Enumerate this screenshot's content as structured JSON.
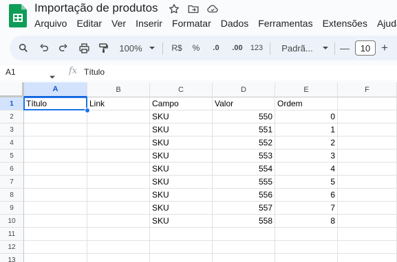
{
  "document": {
    "title": "Importação de produtos"
  },
  "menu": [
    "Arquivo",
    "Editar",
    "Ver",
    "Inserir",
    "Formatar",
    "Dados",
    "Ferramentas",
    "Extensões",
    "Ajuda"
  ],
  "toolbar": {
    "zoom": "100%",
    "currency": "R$",
    "percent": "%",
    "decrease_decimals": ".0",
    "increase_decimals": ".00",
    "number_format": "123",
    "font": "Padrã...",
    "font_size": "10",
    "minus": "—",
    "plus": "+"
  },
  "formula_bar": {
    "cell_ref": "A1",
    "fx": "fx",
    "value": "Título"
  },
  "grid": {
    "columns": [
      "A",
      "B",
      "C",
      "D",
      "E",
      "F"
    ],
    "selected_column": "A",
    "selected_row": "1",
    "row_numbers": [
      "1",
      "2",
      "3",
      "4",
      "5",
      "6",
      "7",
      "8",
      "9",
      "10",
      "11",
      "12",
      "13"
    ],
    "header_row": [
      "Título",
      "Link",
      "Campo",
      "Valor",
      "Ordem",
      ""
    ],
    "rows": [
      [
        "",
        "",
        "SKU",
        "550",
        "0",
        ""
      ],
      [
        "",
        "",
        "SKU",
        "551",
        "1",
        ""
      ],
      [
        "",
        "",
        "SKU",
        "552",
        "2",
        ""
      ],
      [
        "",
        "",
        "SKU",
        "553",
        "3",
        ""
      ],
      [
        "",
        "",
        "SKU",
        "554",
        "4",
        ""
      ],
      [
        "",
        "",
        "SKU",
        "555",
        "5",
        ""
      ],
      [
        "",
        "",
        "SKU",
        "556",
        "6",
        ""
      ],
      [
        "",
        "",
        "SKU",
        "557",
        "7",
        ""
      ],
      [
        "",
        "",
        "SKU",
        "558",
        "8",
        ""
      ],
      [
        "",
        "",
        "",
        "",
        "",
        ""
      ],
      [
        "",
        "",
        "",
        "",
        "",
        ""
      ],
      [
        "",
        "",
        "",
        "",
        "",
        ""
      ]
    ]
  },
  "colors": {
    "accent": "#0b57d0",
    "selection": "#1a73e8",
    "sheets_green": "#0f9d58"
  }
}
